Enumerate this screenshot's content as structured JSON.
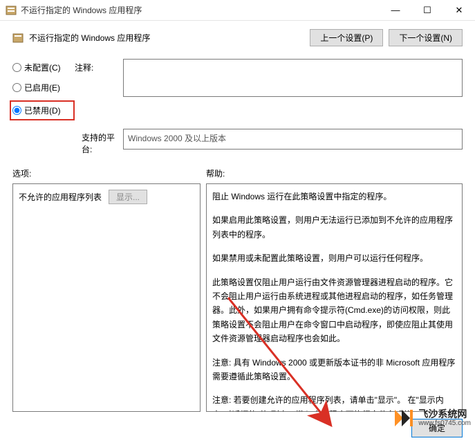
{
  "window": {
    "title": "不运行指定的 Windows 应用程序"
  },
  "header": {
    "policy_title": "不运行指定的 Windows 应用程序",
    "prev_btn": "上一个设置(P)",
    "next_btn": "下一个设置(N)"
  },
  "radios": {
    "not_configured": "未配置(C)",
    "enabled": "已启用(E)",
    "disabled": "已禁用(D)",
    "selected": "disabled"
  },
  "labels": {
    "comment": "注释:",
    "platform": "支持的平台:",
    "options": "选项:",
    "help": "帮助:",
    "list_label": "不允许的应用程序列表",
    "show_btn": "显示..."
  },
  "platform_text": "Windows 2000 及以上版本",
  "help_text": {
    "p1": "阻止 Windows 运行在此策略设置中指定的程序。",
    "p2": "如果启用此策略设置，则用户无法运行已添加到不允许的应用程序列表中的程序。",
    "p3": "如果禁用或未配置此策略设置，则用户可以运行任何程序。",
    "p4": "此策略设置仅阻止用户运行由文件资源管理器进程启动的程序。它不会阻止用户运行由系统进程或其他进程启动的程序，如任务管理器。此外，如果用户拥有命令提示符(Cmd.exe)的访问权限，则此策略设置不会阻止用户在命令窗口中启动程序，即使应阻止其使用文件资源管理器启动程序也会如此。",
    "p5": "注意: 具有 Windows 2000 或更新版本证书的非 Microsoft 应用程序需要遵循此策略设置。",
    "p6": "注意: 若要创建允许的应用程序列表，请单击\"显示\"。 在\"显示内容\"对话框的\"值\"列中，键入应用程序可执行文件名(例如，Winword.exe、Poledit.exe 和 Powerpnt.exe)。"
  },
  "buttons": {
    "ok": "确定"
  },
  "watermark": {
    "site": "飞沙系统网",
    "url": "www.fs0745.com"
  }
}
